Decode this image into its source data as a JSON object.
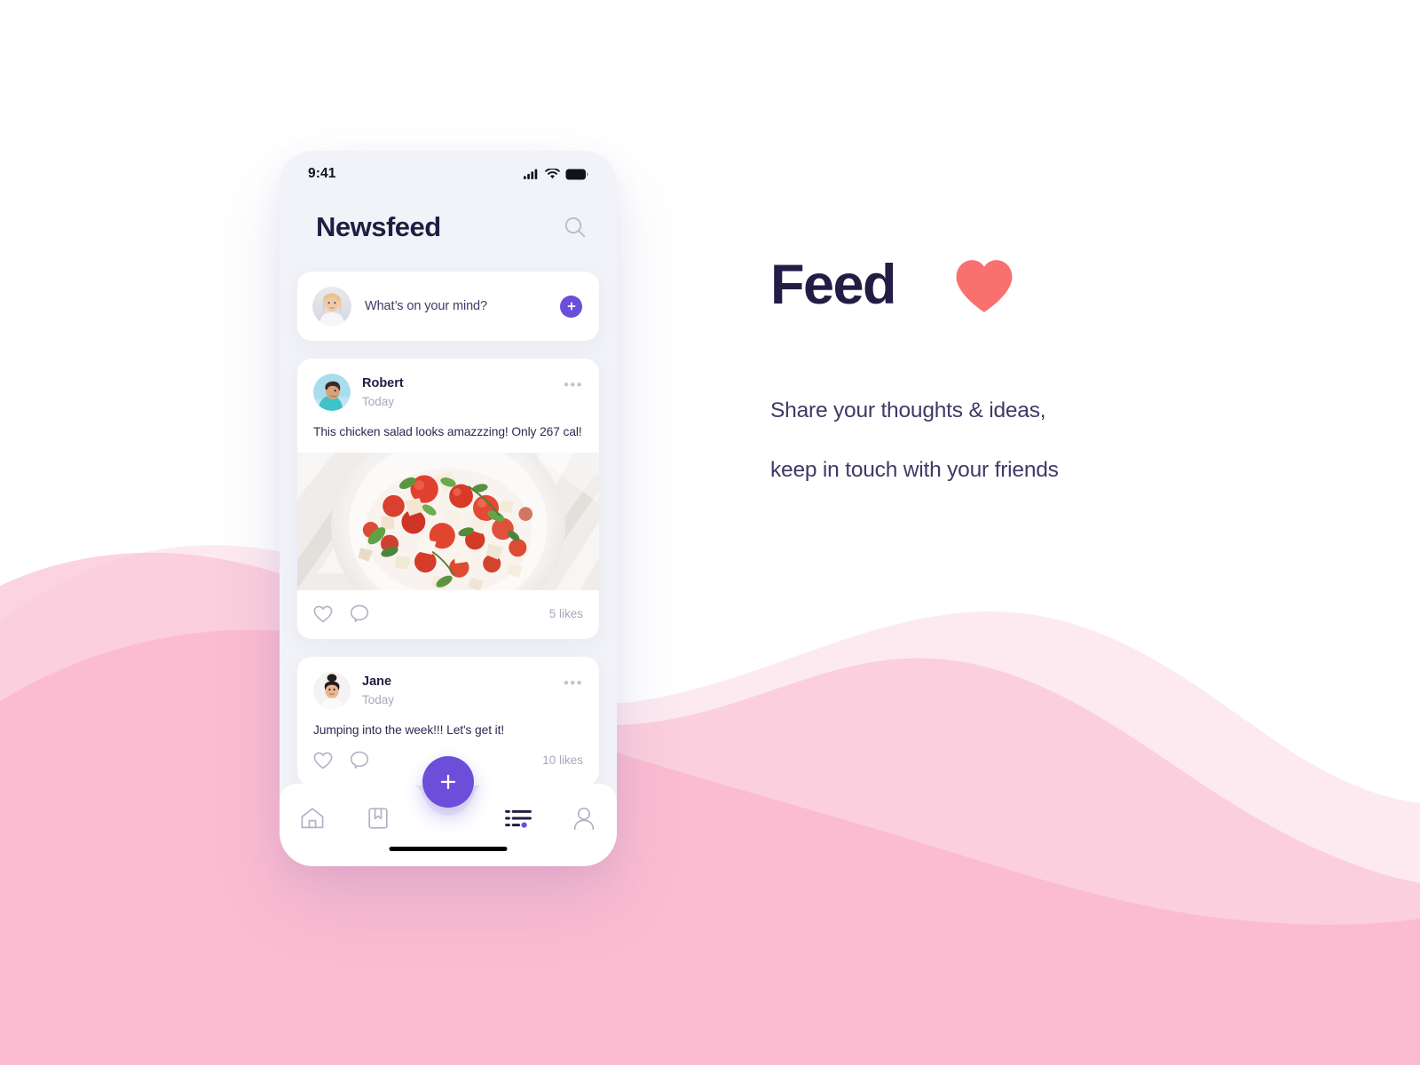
{
  "promo": {
    "title": "Feed",
    "heart_icon": "heart-filled-icon",
    "heart_color": "#F9706E",
    "subtitle_line1": "Share your thoughts & ideas,",
    "subtitle_line2": "keep in touch with your friends"
  },
  "phone": {
    "status_bar": {
      "time": "9:41",
      "signal_icon": "cellular-signal-icon",
      "wifi_icon": "wifi-icon",
      "battery_icon": "battery-full-icon"
    },
    "header": {
      "title": "Newsfeed",
      "search_icon": "search-icon"
    },
    "composer": {
      "avatar_alt": "user-avatar",
      "placeholder": "What’s on your mind?",
      "add_icon": "plus-icon"
    },
    "posts": [
      {
        "author": "Robert",
        "time": "Today",
        "more_icon": "more-horizontal-icon",
        "text": "This chicken salad looks amazzzing! Only 267 cal!",
        "image_alt": "tomato-bread-salad-photo",
        "has_image": true,
        "like_icon": "heart-outline-icon",
        "comment_icon": "comment-bubble-icon",
        "likes": "5 likes"
      },
      {
        "author": "Jane",
        "time": "Today",
        "more_icon": "more-horizontal-icon",
        "text": "Jumping into the week!!! Let's get it!",
        "has_image": false,
        "like_icon": "heart-outline-icon",
        "comment_icon": "comment-bubble-icon",
        "likes": "10 likes"
      }
    ],
    "bottom_nav": {
      "fab_icon": "plus-icon",
      "items": [
        {
          "name": "home",
          "icon": "home-icon",
          "active": false
        },
        {
          "name": "saved",
          "icon": "bookmark-icon",
          "active": false
        },
        {
          "name": "feed",
          "icon": "list-icon",
          "active": true
        },
        {
          "name": "profile",
          "icon": "person-icon",
          "active": false
        }
      ]
    }
  },
  "colors": {
    "accent_purple": "#6B4FD8",
    "heart_coral": "#F9706E",
    "ink": "#211D44",
    "muted": "#A6A7BD",
    "phone_bg": "#F2F3F8",
    "wave_pink": "#FBBFD2",
    "wave_pink_light": "#FDEAF0"
  }
}
